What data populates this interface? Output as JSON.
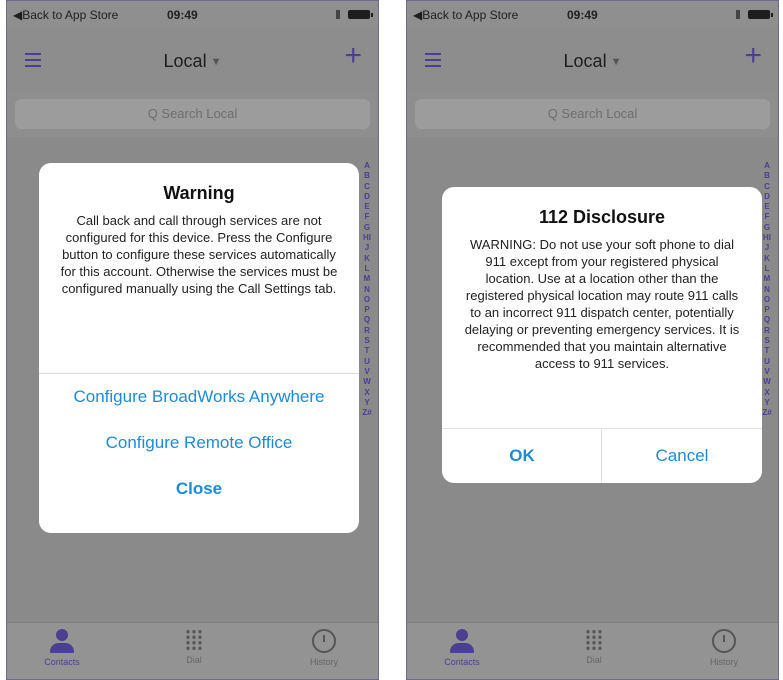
{
  "colors": {
    "accent": "#4b3f8f",
    "link": "#1f8ad8"
  },
  "screens": [
    {
      "status": {
        "back": "◀Back to App Store",
        "time": "09:49"
      },
      "nav": {
        "title": "Local"
      },
      "search": {
        "placeholder": "Q  Search Local"
      },
      "index": "ABCDEFGHIJKLMNOPQRSTUVWXYZ#",
      "tabs": [
        "Contacts",
        "Dial",
        "History"
      ],
      "dialog": {
        "title": "Warning",
        "message": "Call back and call through services are not configured for this device.  Press the Configure button to configure these services automatically for this account.  Otherwise the services must be configured manually using the Call Settings tab.",
        "actions": [
          "Configure BroadWorks Anywhere",
          "Configure Remote Office",
          "Close"
        ]
      }
    },
    {
      "status": {
        "back": "◀Back to App Store",
        "time": "09:49"
      },
      "nav": {
        "title": "Local"
      },
      "search": {
        "placeholder": "Q  Search Local"
      },
      "index": "ABCDEFGHIJKLMNOPQRSTUVWXYZ#",
      "tabs": [
        "Contacts",
        "Dial",
        "History"
      ],
      "dialog": {
        "title": "112 Disclosure",
        "message": "WARNING: Do not use your soft phone to dial 911 except from your registered physical location. Use at a location other than the registered physical location may route 911 calls to an incorrect 911 dispatch center, potentially delaying or preventing emergency services. It is recommended that you maintain alternative access to 911 services.",
        "actions": [
          "OK",
          "Cancel"
        ]
      }
    }
  ]
}
